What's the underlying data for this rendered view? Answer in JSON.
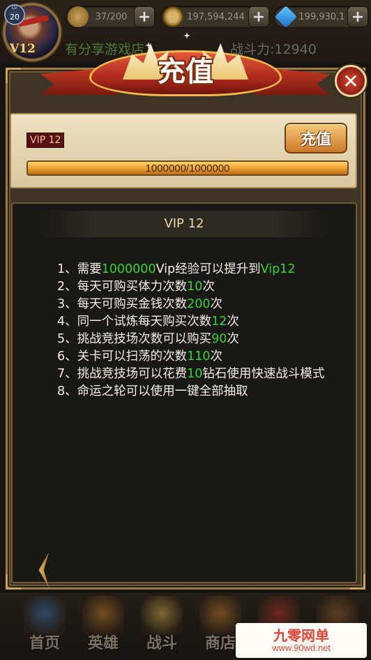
{
  "player": {
    "level_label": "LV",
    "level": "20",
    "vip_label": "V12"
  },
  "resources": [
    {
      "icon": "key-icon",
      "value": "37/200"
    },
    {
      "icon": "coin-icon",
      "value": "197,594,244"
    },
    {
      "icon": "gem-icon",
      "value": "199,930,1"
    }
  ],
  "background_text": {
    "share": "有分享游戏店",
    "power": "战斗力:12940"
  },
  "dialog": {
    "title": "充值",
    "close_label": "✕",
    "vip_level": "VIP 12",
    "recharge_label": "充值",
    "progress_text": "1000000/1000000",
    "progress_fraction": 1.0,
    "content_title": "VIP 12",
    "rules": [
      [
        {
          "t": "1、需要"
        },
        {
          "t": "1000000",
          "hl": true
        },
        {
          "t": "Vip经验可以提升到"
        },
        {
          "t": "Vip12",
          "hl": true
        }
      ],
      [
        {
          "t": "2、每天可购买体力次数"
        },
        {
          "t": "10",
          "hl": true
        },
        {
          "t": "次"
        }
      ],
      [
        {
          "t": "3、每天可购买金钱次数"
        },
        {
          "t": "200",
          "hl": true
        },
        {
          "t": "次"
        }
      ],
      [
        {
          "t": "4、同一个试炼每天购买次数"
        },
        {
          "t": "12",
          "hl": true
        },
        {
          "t": "次"
        }
      ],
      [
        {
          "t": "5、挑战竞技场次数可以购买"
        },
        {
          "t": "90",
          "hl": true
        },
        {
          "t": "次"
        }
      ],
      [
        {
          "t": "6、关卡可以扫荡的次数"
        },
        {
          "t": "110",
          "hl": true
        },
        {
          "t": "次"
        }
      ],
      [
        {
          "t": "7、挑战竞技场可以花费"
        },
        {
          "t": "10",
          "hl": true
        },
        {
          "t": "钻石使用快速战斗模式"
        }
      ],
      [
        {
          "t": "8、命运之轮可以使用一键全部抽取"
        }
      ]
    ]
  },
  "bottom_nav": [
    {
      "label": "首页",
      "icon": "home-icon",
      "color": "#3a6fa8"
    },
    {
      "label": "英雄",
      "icon": "hero-icon",
      "color": "#b8752a"
    },
    {
      "label": "战斗",
      "icon": "battle-icon",
      "color": "#c9a24a"
    },
    {
      "label": "商店",
      "icon": "shop-icon",
      "color": "#b8752a"
    },
    {
      "label": "",
      "icon": "chest-icon",
      "color": "#a8322a"
    },
    {
      "label": "",
      "icon": "more-icon",
      "color": "#8a5a2a"
    }
  ],
  "watermark": {
    "title": "九零网单",
    "url": "www.90wd.net"
  },
  "colors": {
    "highlight_green": "#33d52f",
    "frame_gold": "#9c7d47",
    "banner_red": "#c43b23"
  }
}
